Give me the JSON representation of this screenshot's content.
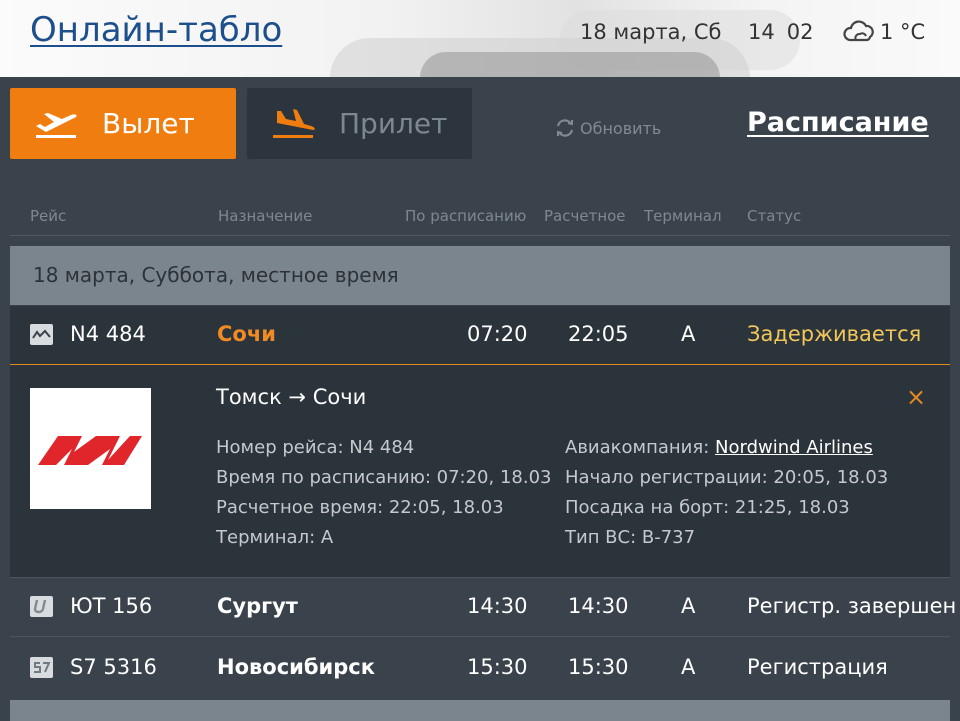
{
  "header": {
    "title": "Онлайн-табло",
    "date": "18 марта, Сб",
    "time_hours": "14",
    "time_minutes": "02",
    "temperature": "1 °C",
    "weather_icon": "cloud-icon"
  },
  "tabs": {
    "departures": {
      "label": "Вылет",
      "icon": "plane-takeoff-icon",
      "active": true,
      "color": "#f07d10"
    },
    "arrivals": {
      "label": "Прилет",
      "icon": "plane-landing-icon",
      "active": false,
      "color": "#2c353d"
    }
  },
  "toolbar": {
    "refresh_label": "Обновить",
    "schedule_label": "Расписание"
  },
  "columns": {
    "flight": "Рейс",
    "destination": "Назначение",
    "scheduled": "По расписанию",
    "estimated": "Расчетное",
    "terminal": "Терминал",
    "status": "Статус"
  },
  "date_group": "18 марта, Суббота, местное время",
  "flights": [
    {
      "flight": "N4 484",
      "destination": "Сочи",
      "scheduled": "07:20",
      "estimated": "22:05",
      "terminal": "A",
      "status": "Задерживается",
      "airline_icon": "nordwind-logo-icon"
    },
    {
      "flight": "ЮТ 156",
      "destination": "Сургут",
      "scheduled": "14:30",
      "estimated": "14:30",
      "terminal": "A",
      "status": "Регистр. завершен",
      "airline_icon": "utair-logo-icon"
    },
    {
      "flight": "S7 5316",
      "destination": "Новосибирск",
      "scheduled": "15:30",
      "estimated": "15:30",
      "terminal": "A",
      "status": "Регистрация",
      "airline_icon": "s7-logo-icon"
    }
  ],
  "detail": {
    "route": "Томск → Сочи",
    "flight_number": "Номер рейса: N4 484",
    "scheduled_time": "Время по расписанию: 07:20, 18.03",
    "estimated_time": "Расчетное время: 22:05, 18.03",
    "terminal": "Терминал: A",
    "airline_label": "Авиакомпания:",
    "airline_name": "Nordwind Airlines",
    "checkin_start": "Начало регистрации: 20:05, 18.03",
    "boarding": "Посадка на борт: 21:25, 18.03",
    "aircraft": "Тип ВС: B-737",
    "close_label": "×"
  },
  "colors": {
    "accent": "#f07d10",
    "board_bg": "#3a434b",
    "status_delayed": "#f2c75a",
    "link": "#1d4f8c"
  }
}
